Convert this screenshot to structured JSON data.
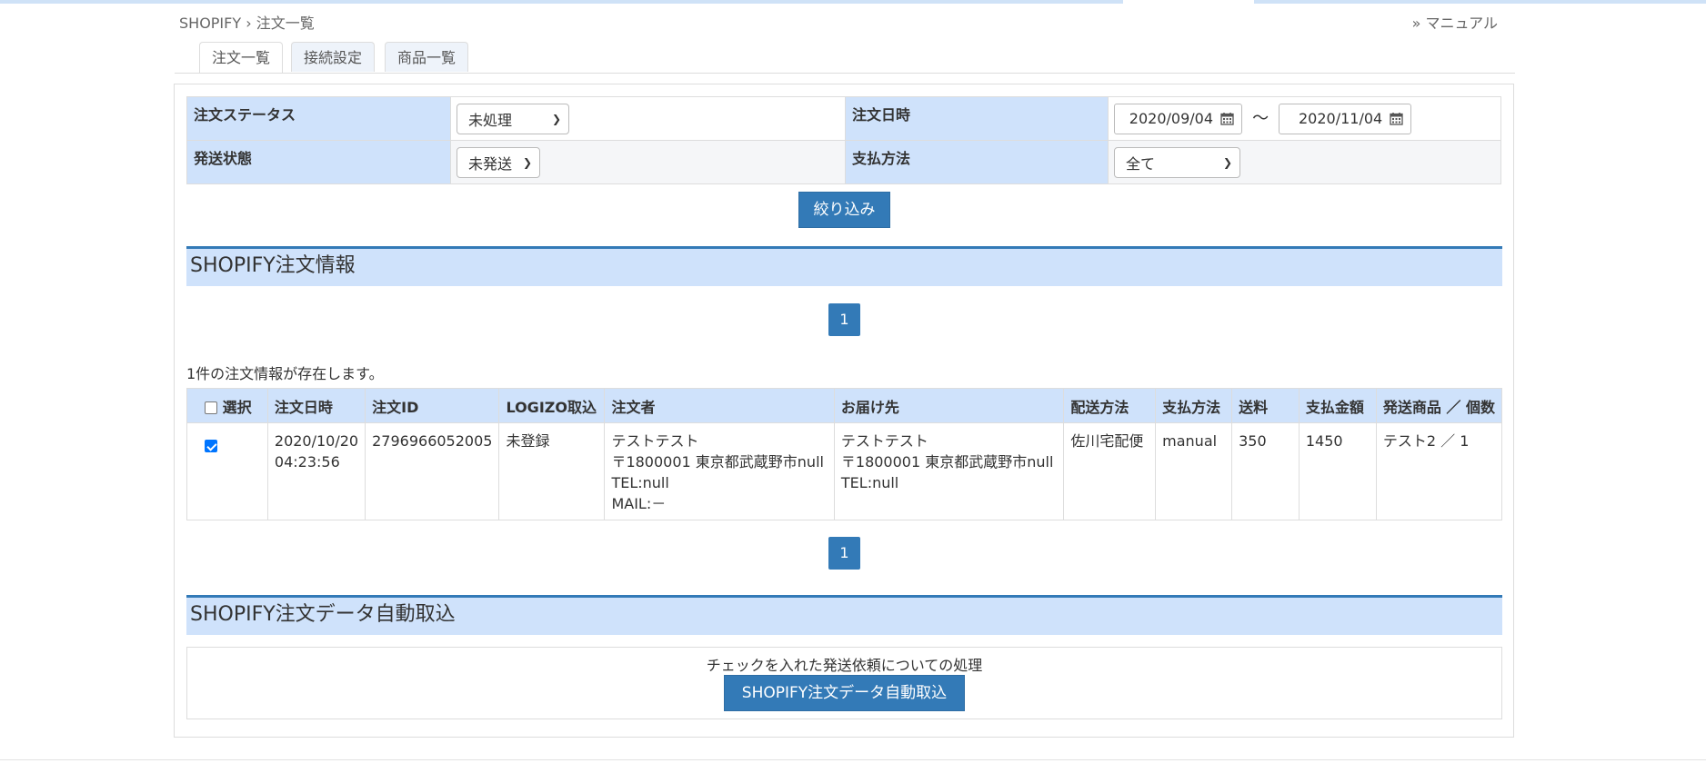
{
  "breadcrumb": {
    "root": "SHOPIFY",
    "sep": "›",
    "current": "注文一覧"
  },
  "manual_link": "» マニュアル",
  "tabs": [
    {
      "label": "注文一覧",
      "active": true
    },
    {
      "label": "接続設定",
      "active": false
    },
    {
      "label": "商品一覧",
      "active": false
    }
  ],
  "filters": {
    "order_status": {
      "label": "注文ステータス",
      "value": "未処理"
    },
    "order_date": {
      "label": "注文日時",
      "from": "2020/09/04",
      "to": "2020/11/04",
      "sep": "〜"
    },
    "shipping_status": {
      "label": "発送状態",
      "value": "未発送"
    },
    "payment_method": {
      "label": "支払方法",
      "value": "全て"
    },
    "submit_label": "絞り込み"
  },
  "orders_section": {
    "title": "SHOPIFY注文情報",
    "page": "1",
    "count_text": "1件の注文情報が存在します。",
    "columns": [
      "選択",
      "注文日時",
      "注文ID",
      "LOGIZO取込",
      "注文者",
      "お届け先",
      "配送方法",
      "支払方法",
      "送料",
      "支払金額",
      "発送商品 ／ 個数"
    ],
    "rows": [
      {
        "checked": true,
        "date": "2020/10/20",
        "time": "04:23:56",
        "order_id": "2796966052005",
        "logizo": "未登録",
        "orderer": [
          "テストテスト",
          "〒1800001 東京都武蔵野市null",
          "TEL:null",
          "MAIL:－"
        ],
        "recipient": [
          "テストテスト",
          "〒1800001 東京都武蔵野市null",
          "TEL:null"
        ],
        "delivery": "佐川宅配便",
        "payment": "manual",
        "shipping_fee": "350",
        "total": "1450",
        "items": "テスト2 ／ 1"
      }
    ]
  },
  "auto_import_section": {
    "title": "SHOPIFY注文データ自動取込",
    "description": "チェックを入れた発送依頼についての処理",
    "button_label": "SHOPIFY注文データ自動取込"
  },
  "colors": {
    "accent": "#337ab7",
    "header_bg": "#cfe2fb"
  }
}
